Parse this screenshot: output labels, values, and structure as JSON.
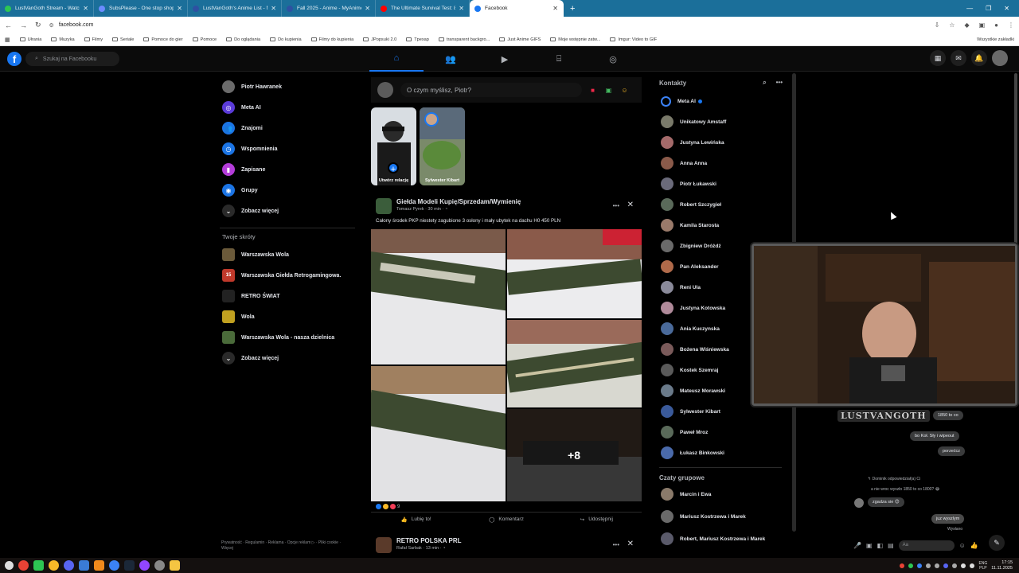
{
  "browser": {
    "tabs": [
      {
        "title": "LustVanGoth Stream - Watch L...",
        "color": "#2dc653",
        "active": false
      },
      {
        "title": "SubsPlease - One stop shop fo...",
        "color": "#6b8cff",
        "active": false
      },
      {
        "title": "LustVanGoth's Anime List - My...",
        "color": "#2e51a2",
        "active": false
      },
      {
        "title": "Fall 2025 - Anime - MyAnimeL...",
        "color": "#2e51a2",
        "active": false
      },
      {
        "title": "The Ultimate Survival Test: 8-Pl...",
        "color": "#ff0000",
        "active": false
      },
      {
        "title": "Facebook",
        "color": "#1877f2",
        "active": true
      }
    ],
    "url": "facebook.com",
    "bookmarks": [
      "Ułrania",
      "Muzyka",
      "Filmy",
      "Seriale",
      "Pomoce do gier",
      "Pomoce",
      "Do oglądania",
      "Do kupienia",
      "Filmy do kupienia",
      "JPopsuki 2.0",
      "Tpexap",
      "transparent backgro...",
      "Just Anime GIFS",
      "Moje wstępnie zatw...",
      "Imgur: Video to GIF"
    ],
    "all_bookmarks": "Wszystkie zakładki"
  },
  "fb": {
    "search_placeholder": "Szukaj na Facebooku",
    "logo": "f"
  },
  "left_nav": {
    "items": [
      {
        "label": "Piotr Hawranek",
        "icon": "avatar",
        "color": "#6b6b6b"
      },
      {
        "label": "Meta AI",
        "icon": "meta-ai-icon",
        "color": "#5b3bd9"
      },
      {
        "label": "Znajomi",
        "icon": "friends-icon",
        "color": "#1b74e4"
      },
      {
        "label": "Wspomnienia",
        "icon": "memories-icon",
        "color": "#1b74e4"
      },
      {
        "label": "Zapisane",
        "icon": "bookmark-icon",
        "color": "#b43cd9"
      },
      {
        "label": "Grupy",
        "icon": "groups-icon",
        "color": "#1b74e4"
      },
      {
        "label": "Zobacz więcej",
        "icon": "chevron-down-icon",
        "color": "#2a2a2a"
      }
    ],
    "shortcuts_heading": "Twoje skróty",
    "shortcuts": [
      {
        "label": "Warszawska Wola",
        "color": "#6b5a3a"
      },
      {
        "label": "Warszawska Giełda Retrogamingowa.",
        "color": "#c0392b",
        "badge": "15"
      },
      {
        "label": "RETRO ŚWIAT",
        "color": "#222"
      },
      {
        "label": "Wola",
        "color": "#c0a020"
      },
      {
        "label": "Warszawska Wola - nasza dzielnica",
        "color": "#4a6b3a"
      },
      {
        "label": "Zobacz więcej",
        "color": "#2a2a2a"
      }
    ],
    "footer": "Prywatność · Regulamin · Reklama · Opcje reklam ▷ · Pliki cookie · Więcej"
  },
  "composer": {
    "placeholder": "O czym myślisz, Piotr?"
  },
  "stories": [
    {
      "label": "Utwórz relację"
    },
    {
      "label": "Sylwester Kibart"
    }
  ],
  "post": {
    "group": "Giełda Modeli Kupię/Sprzedam/Wymienię",
    "author_meta": "Tomasz Pyrek · 30 min · ◔",
    "text": "Całony środek PKP niestety zagubione 3 osłony i mały ubytek na dachu H0 450 PLN",
    "more_photos": "+8",
    "reactions_count": "9",
    "actions": {
      "like": "Lubię to!",
      "comment": "Komentarz",
      "share": "Udostępnij"
    }
  },
  "post2": {
    "group": "RETRO POLSKA PRL",
    "author_meta": "Rafał Sarbak · 13 min · ◔"
  },
  "contacts": {
    "title": "Kontakty",
    "items": [
      {
        "name": "Meta AI",
        "color": "#5b3bd9"
      },
      {
        "name": "Unikatowy Amstaff",
        "color": "#7a7a6a"
      },
      {
        "name": "Justyna Lewińska",
        "color": "#a46a6a"
      },
      {
        "name": "Anna Anna",
        "color": "#8a5a4a"
      },
      {
        "name": "Piotr Łukawski",
        "color": "#6a6a7a"
      },
      {
        "name": "Robert Szczygieł",
        "color": "#5a6a5a"
      },
      {
        "name": "Kamila Starosta",
        "color": "#9a7a6a"
      },
      {
        "name": "Zbigniew Dróżdż",
        "color": "#6a6a6a"
      },
      {
        "name": "Pan Aleksander",
        "color": "#b06a4a"
      },
      {
        "name": "Reni Ula",
        "color": "#8a8a9a"
      },
      {
        "name": "Justyna Kotowska",
        "color": "#b08a9a"
      },
      {
        "name": "Ania Kuczynska",
        "color": "#4a6a9a"
      },
      {
        "name": "Bożena Wiśniewska",
        "color": "#7a5a5a"
      },
      {
        "name": "Kostek Szemraj",
        "color": "#5a5a5a"
      },
      {
        "name": "Mateusz Morawski",
        "color": "#6a7a8a"
      },
      {
        "name": "Sylwester Kibart",
        "color": "#3a5a9a"
      },
      {
        "name": "Paweł Mroz",
        "color": "#5a6a5a"
      },
      {
        "name": "Łukasz Binkowski",
        "color": "#4a6aaa"
      }
    ],
    "group_chats_title": "Czaty grupowe",
    "group_chats": [
      {
        "name": "Marcin i Ewa",
        "color": "#8a7a6a"
      },
      {
        "name": "Mariusz Kostrzewa i Marek",
        "color": "#6a6a6a"
      },
      {
        "name": "Robert, Mariusz Kostrzewa i Marek",
        "color": "#5a5a6a"
      }
    ]
  },
  "overlay": {
    "channel_logo": "LUSTVANGOTH"
  },
  "chat": {
    "messages": [
      {
        "text": "1850 to co",
        "dir": "in"
      },
      {
        "text": "bo Koł. Sły i wipeout",
        "dir": "in"
      },
      {
        "text": "porzećcz",
        "dir": "in"
      },
      {
        "text": "↰ Dominik odpowiedział(a) Ci",
        "dir": "meta"
      },
      {
        "text": "a nie wroc wyszło 1850 to co 1800? 😂",
        "dir": "quote"
      },
      {
        "text": "zgadza sie 😊",
        "dir": "in"
      },
      {
        "text": "juz wyszlym",
        "dir": "out"
      },
      {
        "text": "Wysłano",
        "dir": "meta"
      }
    ],
    "input_placeholder": "Aa"
  },
  "taskbar": {
    "lang": "ENG\nPLP",
    "time": "17:15",
    "date": "11.11.2025"
  }
}
